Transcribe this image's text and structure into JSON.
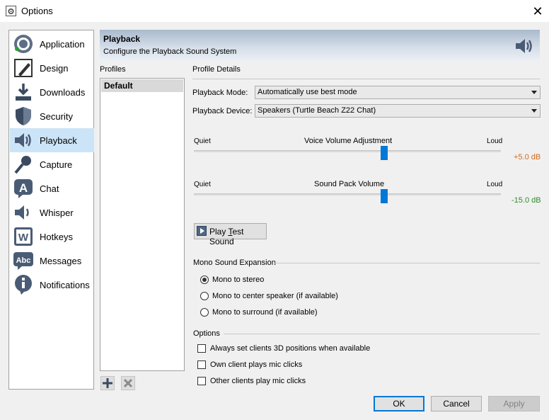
{
  "window": {
    "title": "Options"
  },
  "nav": {
    "items": [
      {
        "label": "Application",
        "icon": "teamspeak-logo-icon"
      },
      {
        "label": "Design",
        "icon": "pen-icon"
      },
      {
        "label": "Downloads",
        "icon": "download-icon"
      },
      {
        "label": "Security",
        "icon": "shield-icon"
      },
      {
        "label": "Playback",
        "icon": "speaker-icon",
        "selected": true
      },
      {
        "label": "Capture",
        "icon": "microphone-icon"
      },
      {
        "label": "Chat",
        "icon": "chat-a-icon"
      },
      {
        "label": "Whisper",
        "icon": "whisper-speaker-icon"
      },
      {
        "label": "Hotkeys",
        "icon": "hotkey-w-icon"
      },
      {
        "label": "Messages",
        "icon": "abc-icon"
      },
      {
        "label": "Notifications",
        "icon": "info-icon"
      }
    ]
  },
  "header": {
    "title": "Playback",
    "subtitle": "Configure the Playback Sound System"
  },
  "profiles": {
    "label": "Profiles",
    "items": [
      "Default"
    ]
  },
  "details": {
    "label": "Profile Details",
    "playback_mode": {
      "label": "Playback Mode:",
      "value": "Automatically use best mode"
    },
    "playback_device": {
      "label": "Playback Device:",
      "value": "Speakers (Turtle Beach Z22 Chat)"
    },
    "voice_volume": {
      "title": "Voice Volume Adjustment",
      "min_label": "Quiet",
      "max_label": "Loud",
      "value_text": "+5.0 dB",
      "position": 0.62,
      "color": "#d2691e"
    },
    "sound_pack": {
      "title": "Sound Pack Volume",
      "min_label": "Quiet",
      "max_label": "Loud",
      "value_text": "-15.0 dB",
      "position": 0.62,
      "color": "#2e8b2e"
    },
    "test_button": {
      "label": "Play Test Sound"
    }
  },
  "mono": {
    "label": "Mono Sound Expansion",
    "options": [
      {
        "label": "Mono to stereo",
        "checked": true
      },
      {
        "label": "Mono to center speaker (if available)",
        "checked": false
      },
      {
        "label": "Mono to surround (if available)",
        "checked": false
      }
    ]
  },
  "options": {
    "label": "Options",
    "items": [
      {
        "label": "Always set clients 3D positions when available",
        "checked": false
      },
      {
        "label": "Own client plays mic clicks",
        "checked": false
      },
      {
        "label": "Other clients play mic clicks",
        "checked": false
      }
    ]
  },
  "buttons": {
    "ok": "OK",
    "cancel": "Cancel",
    "apply": "Apply"
  }
}
